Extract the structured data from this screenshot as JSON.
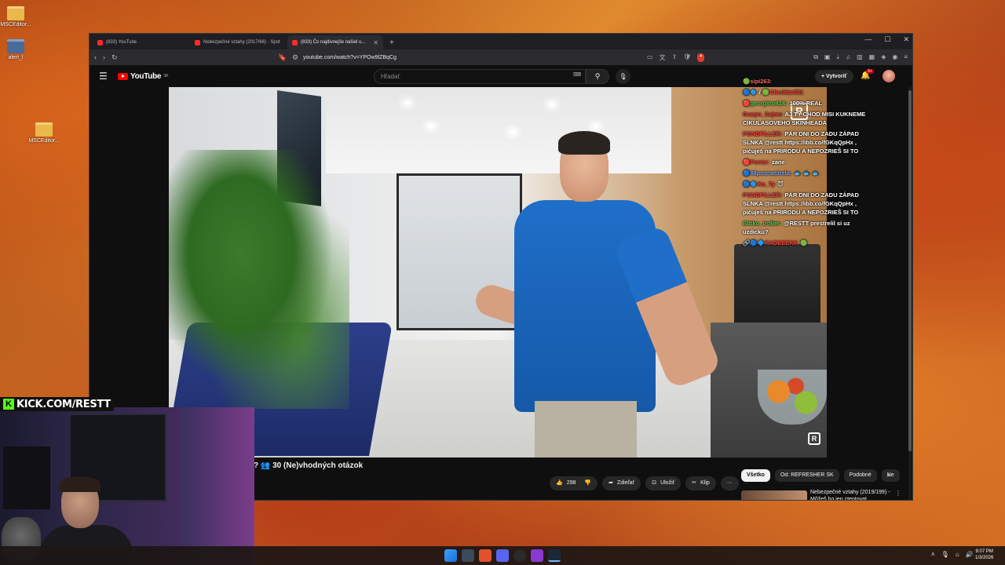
{
  "desktop": {
    "icons": [
      {
        "label": "MSCEditor..."
      },
      {
        "label": "alert_l"
      },
      {
        "label": "MSCEditor..."
      }
    ]
  },
  "browser": {
    "tabs": [
      {
        "title": "(833) YouTube",
        "active": false
      },
      {
        "title": "Nebezpečné vztahy (2017/66) - Spot",
        "active": false
      },
      {
        "title": "(833) Čo najdivnejše našiel u...",
        "active": true
      }
    ],
    "url": "youtube.com/watch?v=YPOw9lZBqCg"
  },
  "youtube": {
    "logo": "YouTube",
    "region": "SK",
    "search_placeholder": "Hľadať",
    "create_label": "Vytvoriť",
    "notif_count": "9+"
  },
  "chat": [
    {
      "user": "sipi263:",
      "color": "#ff6a6a",
      "msg": "",
      "icons": "🟢"
    },
    {
      "user": "Cheddar001",
      "color": "#ff3b3b",
      "msg": "",
      "icons": "🔵🔷 / 🟢"
    },
    {
      "user": "georgino414:",
      "color": "#4bd34b",
      "msg": "100% REAL",
      "icons": "🔴"
    },
    {
      "user": "Guapo_Sajmo",
      "color": "#ff3b3b",
      "msg": "AJ TY CHOD MISI KUKNEME CIKULASOVEHO SKINHEADA",
      "icons": ""
    },
    {
      "user": "PONDFILLER:",
      "color": "#ff3b3b",
      "msg": "PÁR DNI DO ZADU ZÁPAD SLNKA @restt https://ibb.co/fGKqQpHx , pičuješ na PRIRODU A NEPOZRIEŠ SI TO",
      "icons": ""
    },
    {
      "user": "Ferror:",
      "color": "#ff3b3b",
      "msg": "zane",
      "icons": "🔴"
    },
    {
      "user": "88posnastrela:",
      "color": "#7aa8ff",
      "msg": "🐟 🐟 🐟",
      "icons": "🔵"
    },
    {
      "user": "Ko_Ty",
      "color": "#ff3b3b",
      "msg": "😈",
      "icons": "🔵🔷"
    },
    {
      "user": "PONDFILLER:",
      "color": "#ff3b3b",
      "msg": "PÁR DNI DO ZADU ZÁPAD SLNKA @restt https://ibb.co/fGKqQpHx , pičuješ na PRIRODU A NEPOZRIEŠ SI TO",
      "icons": ""
    },
    {
      "user": "Bittko_troller:",
      "color": "#4bd34b",
      "msg": "@RESTT prestrelil si uz uzdicku?",
      "icons": ""
    },
    {
      "user": "RADEEEKK",
      "color": "#ff3b3b",
      "msg": "🟢",
      "icons": "🔗🔵🔷"
    }
  ],
  "video": {
    "title": "? 👥 30 (Ne)vhodných otázok",
    "likes": "298",
    "share_label": "Zdieľať",
    "save_label": "Uložiť",
    "clip_label": "Klip",
    "more_label": "···"
  },
  "chips": [
    "Všetko",
    "Od: REFRESHER SK",
    "Podobné",
    "Ne"
  ],
  "recommendation": {
    "title": "Nebezpečné vztahy (2019/199) - Môžeš ho jen ctentovat"
  },
  "stream": {
    "kick_label": "KICK.COM/RESTT"
  },
  "taskbar": {
    "time": "9:07 PM",
    "date": "1/3/2026"
  }
}
